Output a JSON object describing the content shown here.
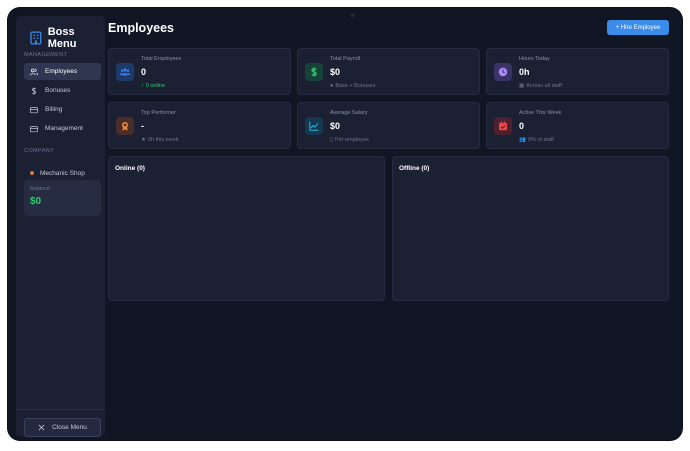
{
  "sidebar": {
    "title": "Boss Menu",
    "management_label": "MANAGEMENT",
    "items": [
      {
        "label": "Employees",
        "icon": "users-icon",
        "active": true
      },
      {
        "label": "Bonuses",
        "icon": "dollar-icon",
        "active": false
      },
      {
        "label": "Billing",
        "icon": "credit-card-icon",
        "active": false
      },
      {
        "label": "Management",
        "icon": "card-icon",
        "active": false
      }
    ],
    "company_label": "COMPANY",
    "company_name": "Mechanic Shop",
    "balance_label": "Balance",
    "balance_value": "$0",
    "close_label": "Close Menu"
  },
  "header": {
    "title": "Employees",
    "hire_label": "+ Hire Employee"
  },
  "stats": [
    {
      "label": "Total Employees",
      "value": "0",
      "sub": "0 online",
      "sub_icon": "arrow-up-icon",
      "icon": "users-group-icon",
      "icon_color": "#3b82f6",
      "icon_bg": "#1e3a66"
    },
    {
      "label": "Total Payroll",
      "value": "$0",
      "sub": "Base + Bonuses",
      "sub_icon": "info-icon",
      "icon": "dollar-icon",
      "icon_color": "#2ecc71",
      "icon_bg": "#17423a"
    },
    {
      "label": "Hours Today",
      "value": "0h",
      "sub": "Across all staff",
      "sub_icon": "calendar-icon",
      "icon": "clock-icon",
      "icon_color": "#a78bfa",
      "icon_bg": "#3b3266"
    },
    {
      "label": "Top Performer",
      "value": "-",
      "sub": "0h this week",
      "sub_icon": "star-icon",
      "icon": "award-icon",
      "icon_color": "#f08a3c",
      "icon_bg": "#4a2d28"
    },
    {
      "label": "Average Salary",
      "value": "$0",
      "sub": "Per employee",
      "sub_icon": "receipt-icon",
      "icon": "chart-line-icon",
      "icon_color": "#22b5e0",
      "icon_bg": "#16384e"
    },
    {
      "label": "Active This Week",
      "value": "0",
      "sub": "0% of staff",
      "sub_icon": "users-icon",
      "icon": "calendar-check-icon",
      "icon_color": "#ef4444",
      "icon_bg": "#4d2030"
    }
  ],
  "panels": {
    "online": "Online (0)",
    "offline": "Offline (0)"
  }
}
